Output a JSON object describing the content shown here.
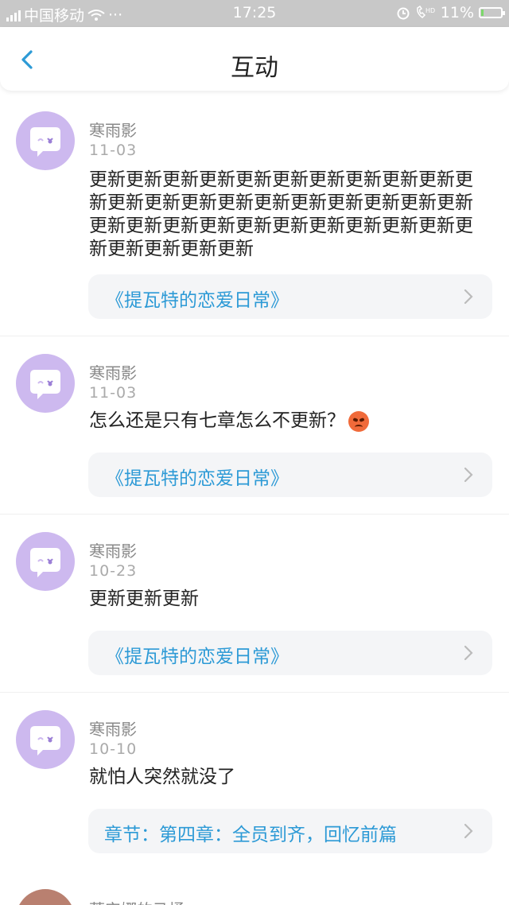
{
  "status_bar": {
    "carrier": "中国移动",
    "dots": "···",
    "time": "17:25",
    "battery_text": "11%",
    "battery_level": 0.11
  },
  "header": {
    "title": "互动",
    "back_icon": "chevron-left-icon"
  },
  "colors": {
    "accent": "#2d9ad6",
    "avatar_bg": "#cdb9ef",
    "link_bg": "#f4f5f7"
  },
  "posts": [
    {
      "name": "寒雨影",
      "date": "11-03",
      "text": "更新更新更新更新更新更新更新更新更新更新更新更新更新更新更新更新更新更新更新更新更新更新更新更新更新更新更新更新更新更新更新更新更新更新更新更新",
      "link": "《提瓦特的恋爱日常》"
    },
    {
      "name": "寒雨影",
      "date": "11-03",
      "text": "怎么还是只有七章怎么不更新？",
      "emoji": "angry-face-icon",
      "link": "《提瓦特的恋爱日常》"
    },
    {
      "name": "寒雨影",
      "date": "10-23",
      "text": "更新更新更新",
      "link": "《提瓦特的恋爱日常》"
    },
    {
      "name": "寒雨影",
      "date": "10-10",
      "text": "就怕人突然就没了",
      "link": "章节：第四章：全员到齐，回忆前篇"
    }
  ],
  "partial_post": {
    "name": "蒂安娜的马桶"
  }
}
